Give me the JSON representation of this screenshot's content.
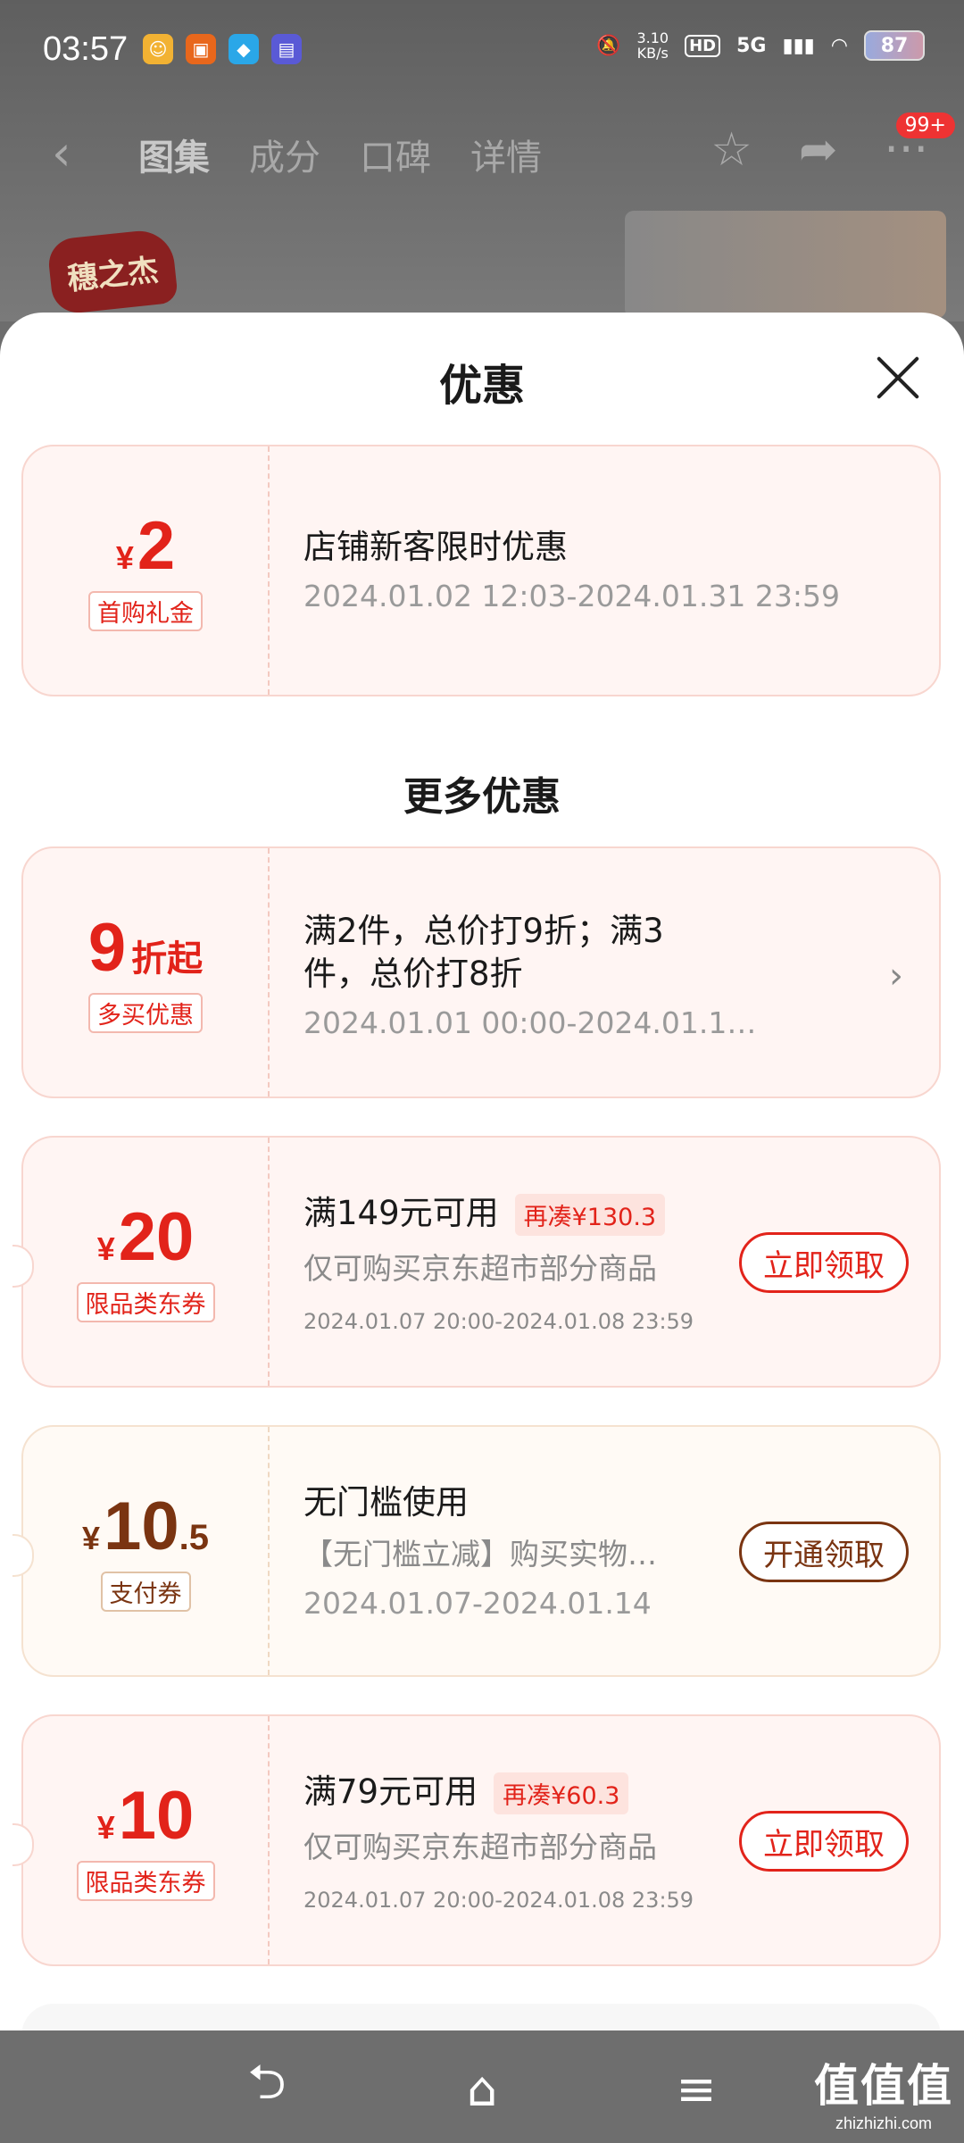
{
  "status_bar": {
    "time": "03:57",
    "net_speed_value": "3.10",
    "net_speed_unit": "KB/s",
    "hd": "HD",
    "network": "5G",
    "battery": "87"
  },
  "product_nav": {
    "tabs": [
      "图集",
      "成分",
      "口碑",
      "详情"
    ],
    "cart_badge": "99+",
    "brand_logo_text": "穗之杰"
  },
  "sheet": {
    "title": "优惠",
    "more_title": "更多优惠"
  },
  "coupons": [
    {
      "amount_symbol": "¥",
      "amount": "2",
      "tag": "首购礼金",
      "title": "店铺新客限时优惠",
      "date": "2024.01.02 12:03-2024.01.31 23:59"
    },
    {
      "amount": "9",
      "amount_suffix": "折起",
      "tag": "多买优惠",
      "title_line1": "满2件，总价打9折；满3",
      "title_line2": "件，总价打8折",
      "date": "2024.01.01 00:00-2024.01.1…"
    },
    {
      "amount_symbol": "¥",
      "amount": "20",
      "tag": "限品类东券",
      "title": "满149元可用",
      "diff_tag": "再凑¥130.3",
      "subtitle": "仅可购买京东超市部分商品",
      "date": "2024.01.07 20:00-2024.01.08 23:59",
      "action": "立即领取"
    },
    {
      "amount_symbol": "¥",
      "amount": "10",
      "amount_decimal": ".5",
      "tag": "支付券",
      "title": "无门槛使用",
      "subtitle": "【无门槛立减】购买实物…",
      "date": "2024.01.07-2024.01.14",
      "action": "开通领取"
    },
    {
      "amount_symbol": "¥",
      "amount": "10",
      "tag": "限品类东券",
      "title": "满79元可用",
      "diff_tag": "再凑¥60.3",
      "subtitle": "仅可购买京东超市部分商品",
      "date": "2024.01.07 20:00-2024.01.08 23:59",
      "action": "立即领取"
    }
  ],
  "watermark": {
    "main": "值值值",
    "sub": "zhizhizhi.com"
  },
  "colors": {
    "accent_red": "#e2231a",
    "accent_brown": "#7a3411"
  }
}
